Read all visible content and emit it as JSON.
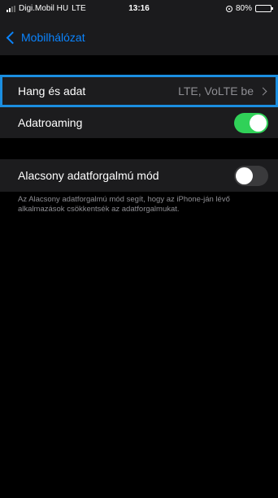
{
  "status_bar": {
    "carrier": "Digi.Mobil HU",
    "network": "LTE",
    "time": "13:16",
    "battery": "80%",
    "battery_level": 0.8
  },
  "nav": {
    "back_label": "Mobilhálózat"
  },
  "voice_data": {
    "label": "Hang és adat",
    "value": "LTE, VoLTE be"
  },
  "roaming": {
    "label": "Adatroaming",
    "enabled": true
  },
  "low_data": {
    "label": "Alacsony adatforgalmú mód",
    "enabled": false,
    "description": "Az Alacsony adatforgalmú mód segít, hogy az iPhone-ján lévő alkalmazások csökkentsék az adatforgalmukat."
  },
  "colors": {
    "accent": "#0a84ff",
    "toggle_on": "#30d158",
    "highlight_border": "#1b8ee0"
  }
}
